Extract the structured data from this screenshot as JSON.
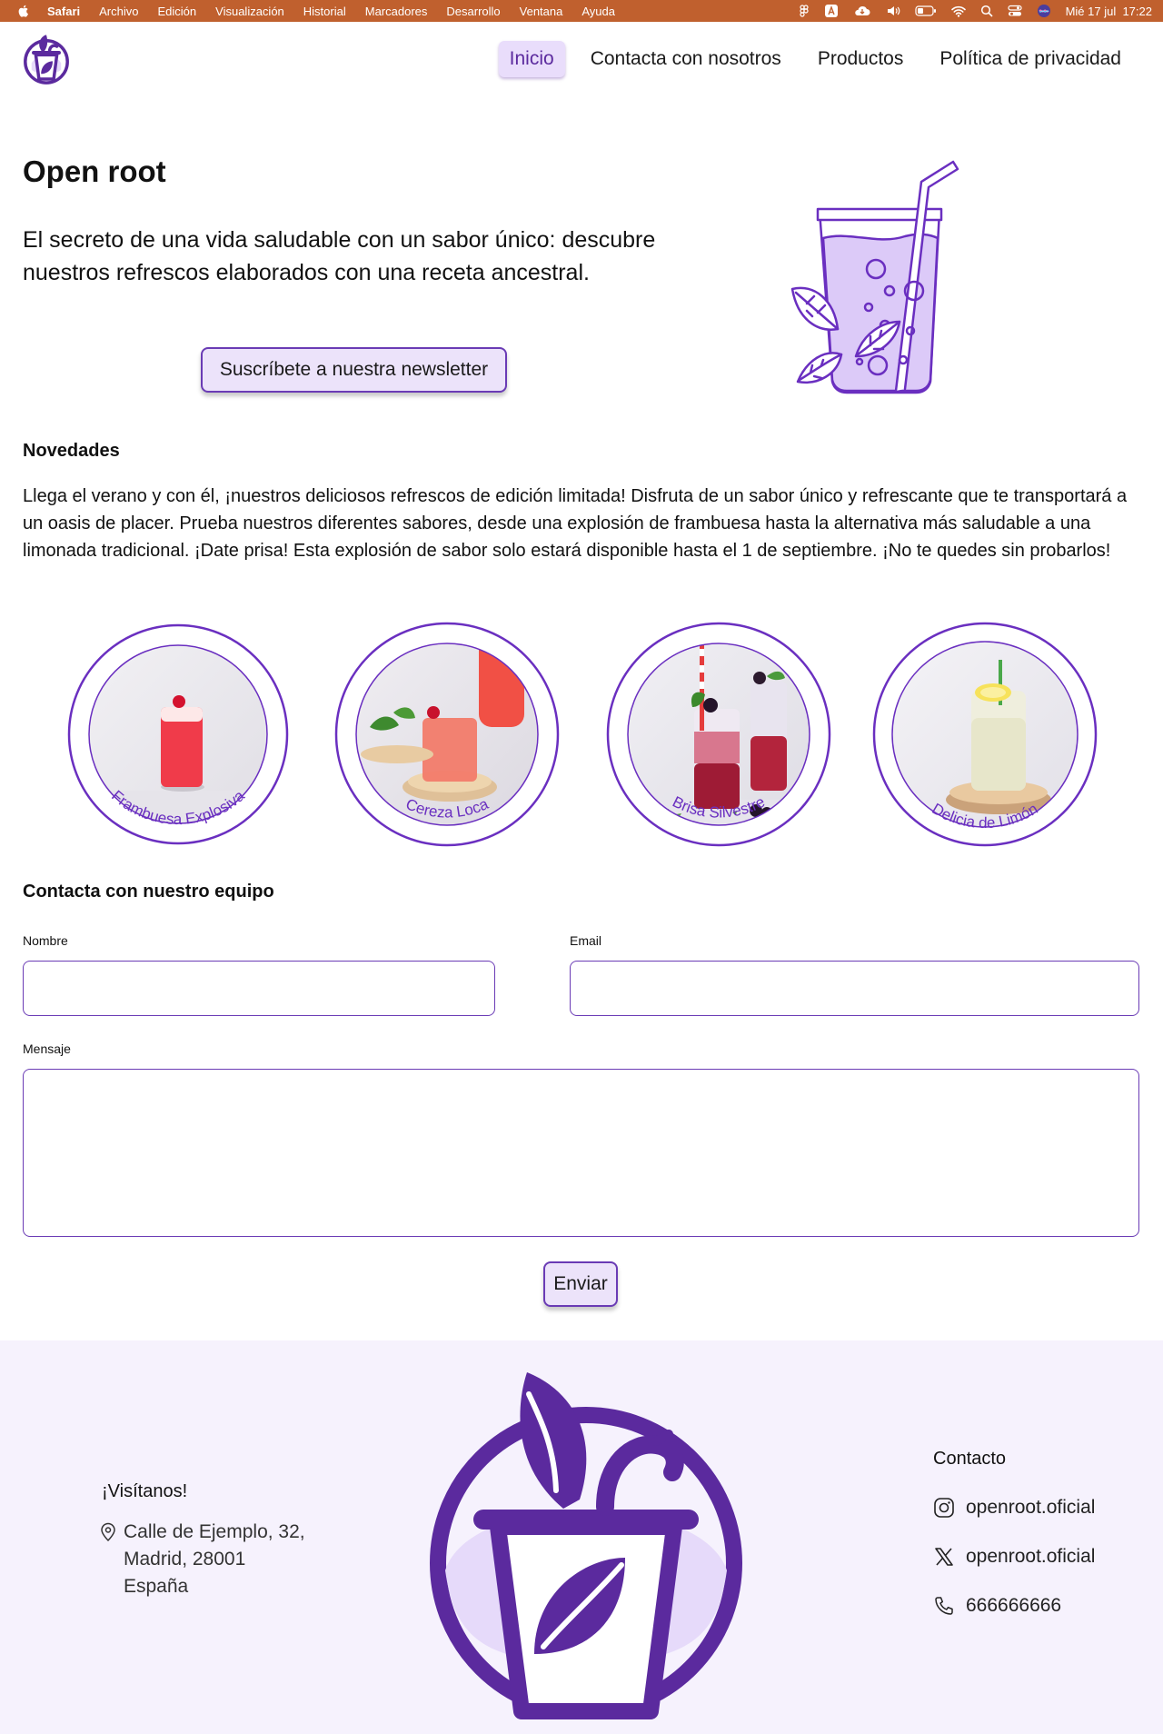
{
  "menubar": {
    "app": "Safari",
    "items": [
      "Archivo",
      "Edición",
      "Visualización",
      "Historial",
      "Marcadores",
      "Desarrollo",
      "Ventana",
      "Ayuda"
    ],
    "clock": "Mié 17 jul  17:22"
  },
  "nav": {
    "items": [
      "Inicio",
      "Contacta con nosotros",
      "Productos",
      "Política de privacidad"
    ],
    "active": "Inicio"
  },
  "hero": {
    "title": "Open root",
    "text": "El secreto de una vida saludable con un sabor único: descubre nuestros refrescos elaborados con una receta ancestral.",
    "button": "Suscríbete a nuestra newsletter"
  },
  "news": {
    "title": "Novedades",
    "text": "Llega el verano y con él, ¡nuestros deliciosos refrescos de edición limitada! Disfruta de un sabor único y refrescante que te transportará a un oasis de placer. Prueba nuestros diferentes sabores, desde una explosión de frambuesa hasta la alternativa más saludable a una limonada tradicional. ¡Date prisa! Esta explosión de sabor solo estará disponible hasta el 1 de septiembre. ¡No te quedes sin probarlos!"
  },
  "products": [
    {
      "name": "Frambuesa Explosiva"
    },
    {
      "name": "Cereza Loca"
    },
    {
      "name": "Brisa Silvestre"
    },
    {
      "name": "Delicia de Limón"
    }
  ],
  "contact": {
    "title": "Contacta con nuestro equipo",
    "name_label": "Nombre",
    "email_label": "Email",
    "message_label": "Mensaje",
    "send": "Enviar"
  },
  "footer": {
    "visit_title": "¡Visítanos!",
    "address": [
      "Calle de Ejemplo, 32,",
      "Madrid, 28001",
      "España"
    ],
    "contact_title": "Contacto",
    "instagram": "openroot.oficial",
    "x": "openroot.oficial",
    "phone": "666666666"
  },
  "colors": {
    "brand": "#5b2a9e",
    "accent_light": "#ece3fa",
    "menubar": "#c0602e",
    "footer_bg": "#f6f2fd"
  }
}
